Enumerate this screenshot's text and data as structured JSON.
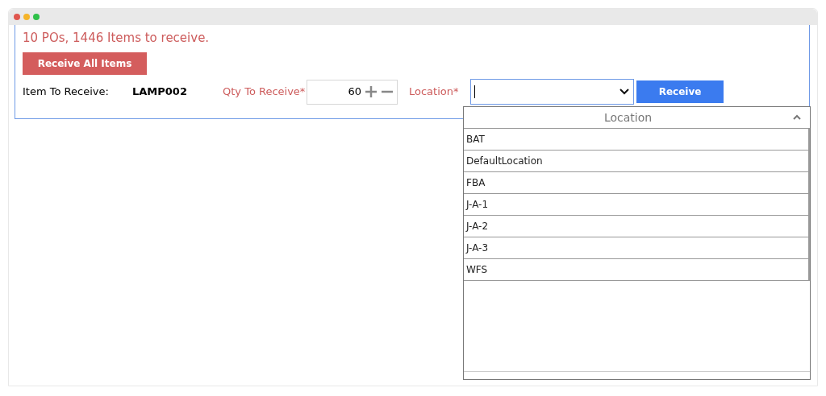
{
  "summary": "10 POs, 1446 Items to receive.",
  "receive_all_button": "Receive All Items",
  "item_label": "Item To Receive:",
  "item_value": "LAMP002",
  "qty": {
    "label": "Qty To Receive*",
    "value": "60"
  },
  "location": {
    "label": "Location*",
    "expanded": true
  },
  "receive_button": "Receive",
  "dropdown": {
    "header": "Location",
    "items": [
      {
        "label": "BAT"
      },
      {
        "label": "DefaultLocation"
      },
      {
        "label": "FBA"
      },
      {
        "label": "J-A-1"
      },
      {
        "label": "J-A-2"
      },
      {
        "label": "J-A-3"
      },
      {
        "label": "WFS"
      }
    ]
  }
}
